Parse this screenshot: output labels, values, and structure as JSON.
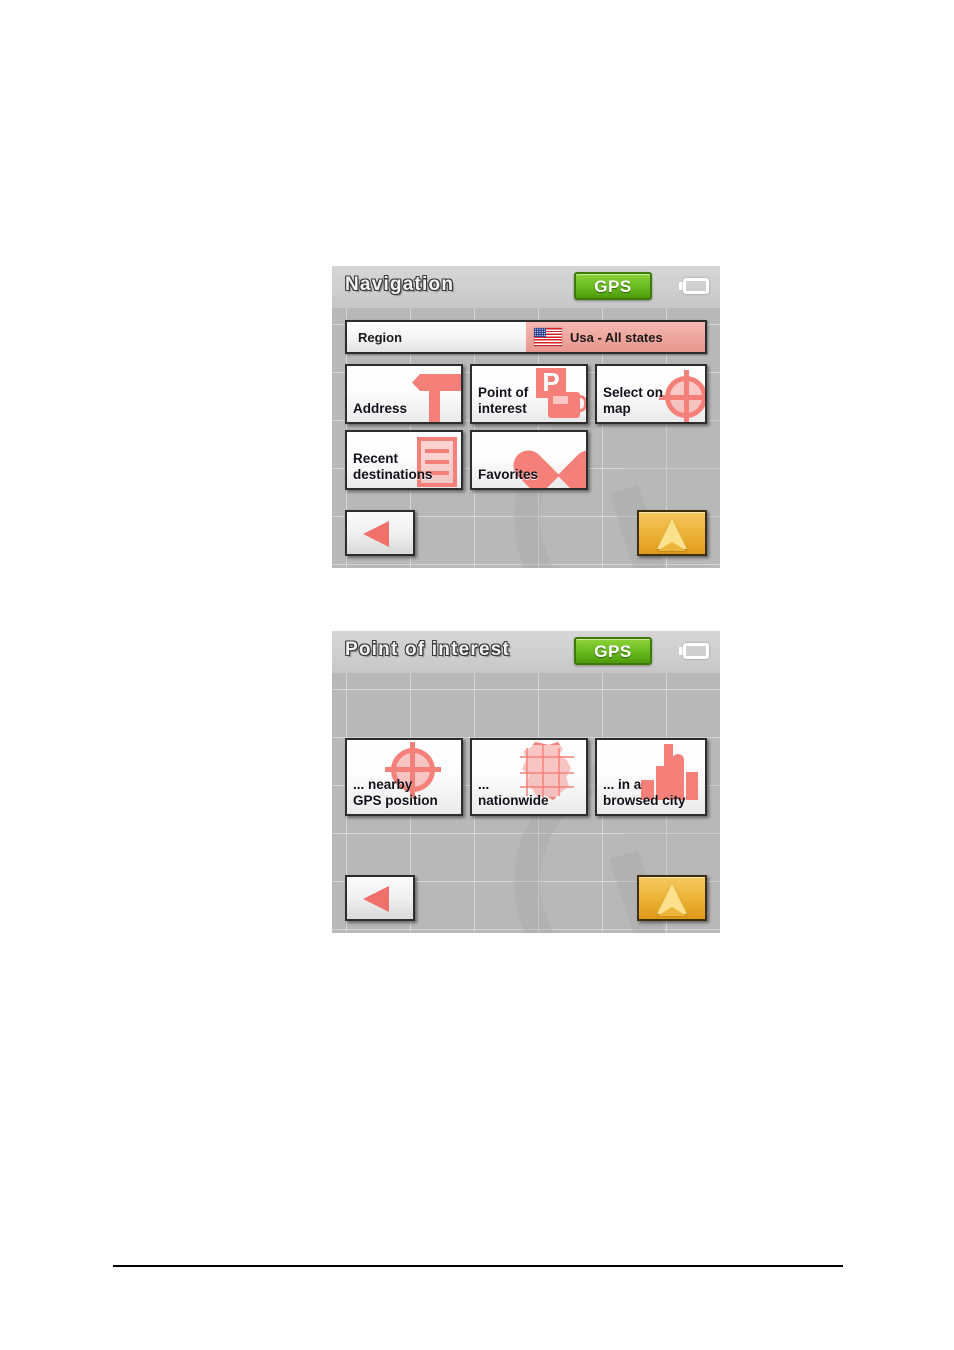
{
  "page": {
    "background_color": "#ffffff",
    "footer_rule_color": "#000000"
  },
  "theme": {
    "screen_background": "#b8b8b8",
    "titlebar_background": "#cfcfcf",
    "accent_salmon": "#f5807a",
    "gps_green": "#71c226",
    "go_button_amber": "#eeb53c",
    "tile_background": "#ffffff",
    "tile_border": "#2d2d2d"
  },
  "screens": [
    {
      "id": "navigation",
      "title": "Navigation",
      "status": {
        "gps_label": "GPS",
        "gps_state": "active",
        "battery_icon": "battery-icon"
      },
      "region_row": {
        "label": "Region",
        "value": "Usa - All states",
        "flag_icon": "usa-flag-icon"
      },
      "tiles": [
        {
          "label_line1": "Address",
          "label_line2": "",
          "icon": "signpost-icon"
        },
        {
          "label_line1": "Point of",
          "label_line2": "interest",
          "icon": "parking-fuel-icon"
        },
        {
          "label_line1": "Select on",
          "label_line2": "map",
          "icon": "crosshair-icon"
        },
        {
          "label_line1": "Recent",
          "label_line2": "destinations",
          "icon": "list-document-icon"
        },
        {
          "label_line1": "Favorites",
          "label_line2": "",
          "icon": "heart-icon"
        }
      ],
      "bottom_bar": {
        "back_icon": "back-arrow-icon",
        "go_icon": "navigation-cursor-icon"
      }
    },
    {
      "id": "poi",
      "title": "Point of interest",
      "status": {
        "gps_label": "GPS",
        "gps_state": "active",
        "battery_icon": "battery-icon"
      },
      "tiles": [
        {
          "label_line1": "... nearby",
          "label_line2": "GPS position",
          "icon": "radar-position-icon"
        },
        {
          "label_line1": "...",
          "label_line2": "nationwide",
          "icon": "country-map-icon"
        },
        {
          "label_line1": "... in a",
          "label_line2": "browsed city",
          "icon": "city-skyline-icon"
        }
      ],
      "bottom_bar": {
        "back_icon": "back-arrow-icon",
        "go_icon": "navigation-cursor-icon"
      }
    }
  ]
}
